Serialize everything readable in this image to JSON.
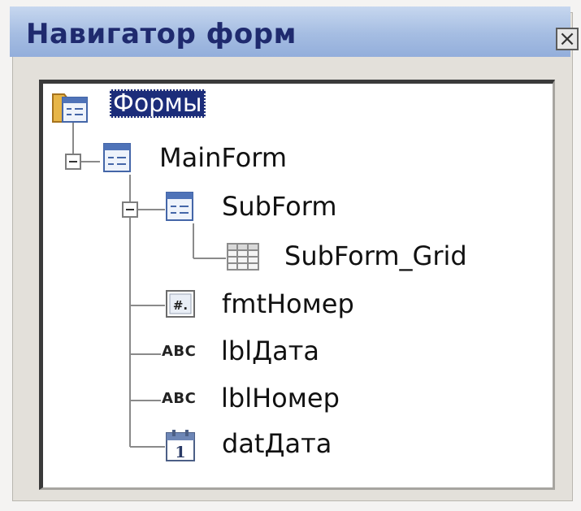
{
  "window": {
    "title": "Навигатор форм",
    "close_glyph": "×"
  },
  "tree": {
    "root": {
      "label": "Формы",
      "icon": "forms-folder-icon",
      "selected": true
    },
    "main_form": {
      "label": "MainForm",
      "icon": "form-icon",
      "expanded": true
    },
    "sub_form": {
      "label": "SubForm",
      "icon": "form-icon",
      "expanded": true
    },
    "sub_form_grid": {
      "label": "SubForm_Grid",
      "icon": "table-grid-icon"
    },
    "fmt_nomer": {
      "label": "fmtНомер",
      "icon": "formatted-field-icon",
      "icon_text": "#."
    },
    "lbl_data": {
      "label": "lblДата",
      "icon": "label-abc-icon",
      "icon_text": "ABC"
    },
    "lbl_nomer": {
      "label": "lblНомер",
      "icon": "label-abc-icon",
      "icon_text": "ABC"
    },
    "dat_data": {
      "label": "datДата",
      "icon": "date-field-icon",
      "icon_text": "1"
    }
  }
}
